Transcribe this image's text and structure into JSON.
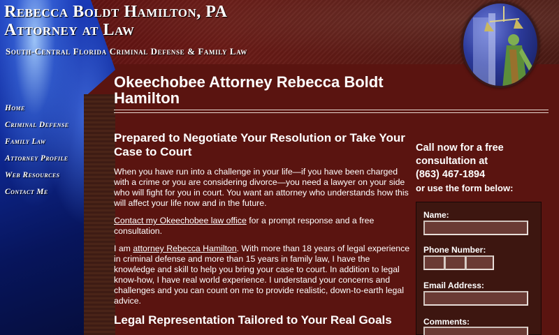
{
  "header": {
    "title_line1": "Rebecca Boldt Hamilton, PA",
    "title_line2": "Attorney at Law",
    "tagline": "South-Central Florida Criminal Defense & Family Law"
  },
  "nav": {
    "items": [
      {
        "label": "Home"
      },
      {
        "label": "Criminal Defense"
      },
      {
        "label": "Family Law"
      },
      {
        "label": "Attorney Profile"
      },
      {
        "label": "Web Resources"
      },
      {
        "label": "Contact Me"
      }
    ]
  },
  "main": {
    "title": "Okeechobee Attorney Rebecca Boldt Hamilton",
    "heading1": "Prepared to Negotiate Your Resolution or Take Your Case to Court",
    "para1": "When you have run into a challenge in your life—if you have been charged with a crime or you are considering divorce—you need a lawyer on your side who will fight for you in court. You want an attorney who understands how this will affect your life now and in the future.",
    "para2_link": "Contact my Okeechobee law office",
    "para2_rest": " for a prompt response and a free consultation.",
    "para3_start": "I am ",
    "para3_link": "attorney Rebecca Hamilton",
    "para3_rest": ". With more than 18 years of legal experience in criminal defense and more than 15 years in family law, I have the knowledge and skill to help you bring your case to court. In addition to legal know-how, I have real world experience. I understand your concerns and challenges and you can count on me to provide realistic, down-to-earth legal advice.",
    "heading2": "Legal Representation Tailored to Your Real Goals"
  },
  "sidebar_cta": {
    "line1": "Call now for a free",
    "line2": "consultation at",
    "phone": "(863) 467-1894",
    "line4": "or use the form below:"
  },
  "form": {
    "name_label": "Name:",
    "name_value": "",
    "phone_label": "Phone Number:",
    "phone_area": "",
    "phone_prefix": "",
    "phone_line": "",
    "email_label": "Email Address:",
    "email_value": "",
    "comments_label": "Comments:",
    "comments_value": ""
  },
  "colors": {
    "background": "#5a1410",
    "form_box": "#3d1610",
    "input_fill": "#6a3a34",
    "accent_blue": "#1c3ec0"
  }
}
